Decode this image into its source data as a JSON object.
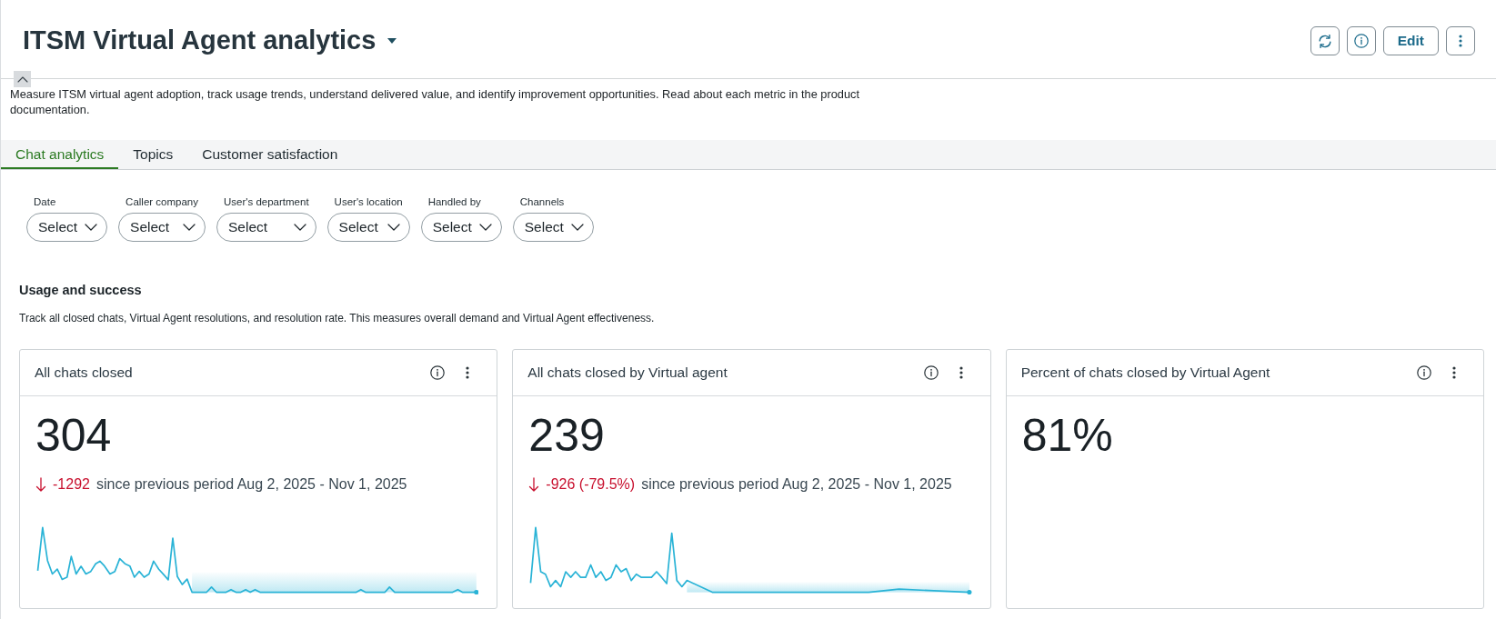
{
  "header": {
    "title": "ITSM Virtual Agent analytics",
    "actions": [
      {
        "kind": "refresh"
      },
      {
        "kind": "info"
      },
      {
        "kind": "text",
        "label": "Edit"
      },
      {
        "kind": "more"
      }
    ]
  },
  "description": "Measure ITSM virtual agent adoption, track usage trends, understand delivered value, and identify improvement opportunities. Read about each metric in the product documentation.",
  "tabs": [
    {
      "label": "Chat analytics",
      "selected": true
    },
    {
      "label": "Topics",
      "selected": false
    },
    {
      "label": "Customer satisfaction",
      "selected": false
    }
  ],
  "filters": [
    {
      "label": "Date",
      "value": "Select"
    },
    {
      "label": "Caller company",
      "value": "Select"
    },
    {
      "label": "User's department",
      "value": "Select"
    },
    {
      "label": "User's location",
      "value": "Select"
    },
    {
      "label": "Handled by",
      "value": "Select"
    },
    {
      "label": "Channels",
      "value": "Select"
    }
  ],
  "section": {
    "title": "Usage and success",
    "description": "Track all closed chats, Virtual Agent resolutions, and resolution rate. This measures overall demand and Virtual Agent effectiveness."
  },
  "cards": [
    {
      "title": "All chats closed",
      "value": "304",
      "delta": {
        "kind": "down",
        "value": "-1292",
        "text": "since previous period Aug 2, 2025 - Nov 1, 2025"
      },
      "sparkline": true
    },
    {
      "title": "All chats closed by Virtual agent",
      "value": "239",
      "delta": {
        "kind": "down",
        "value": "-926 (-79.5%)",
        "text": "since previous period Aug 2, 2025 - Nov 1, 2025"
      },
      "sparkline": true
    },
    {
      "title": "Percent of chats closed by Virtual Agent",
      "value": "81%"
    }
  ]
}
